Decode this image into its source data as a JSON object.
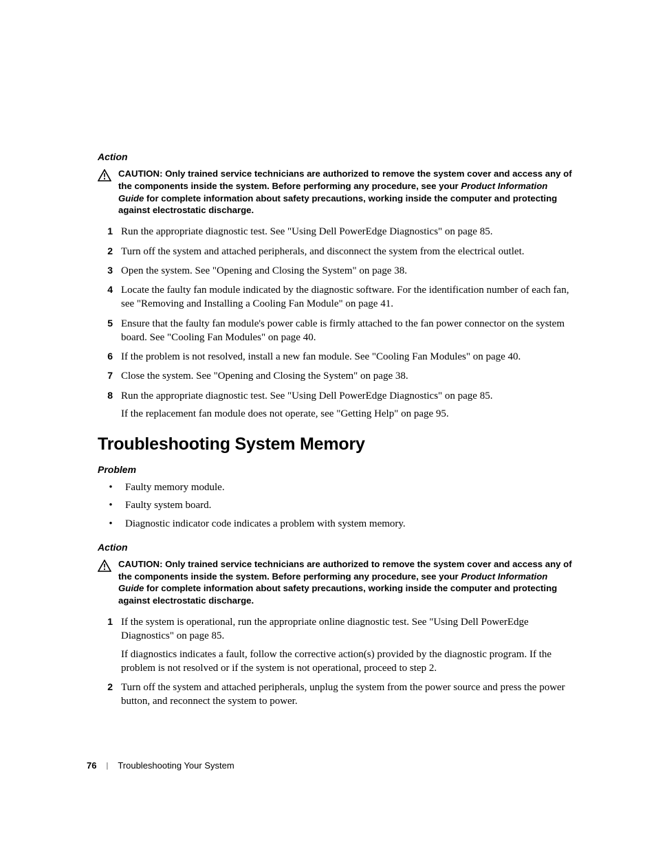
{
  "section1": {
    "subhead": "Action",
    "caution": {
      "label": "CAUTION:",
      "text1": " Only trained service technicians are authorized to remove the system cover and access any of the components inside the system. Before performing any procedure, see your ",
      "pig": "Product Information Guide",
      "text2": " for complete information about safety precautions, working inside the computer and protecting against electrostatic discharge."
    },
    "steps": [
      {
        "n": "1",
        "text": "Run the appropriate diagnostic test. See \"Using Dell PowerEdge Diagnostics\" on page 85."
      },
      {
        "n": "2",
        "text": "Turn off the system and attached peripherals, and disconnect the system from the electrical outlet."
      },
      {
        "n": "3",
        "text": "Open the system. See \"Opening and Closing the System\" on page 38."
      },
      {
        "n": "4",
        "text": "Locate the faulty fan module indicated by the diagnostic software. For the identification number of each fan, see \"Removing and Installing a Cooling Fan Module\" on page 41."
      },
      {
        "n": "5",
        "text": "Ensure that the faulty fan module's power cable is firmly attached to the fan power connector on the system board. See \"Cooling Fan Modules\" on page 40."
      },
      {
        "n": "6",
        "text": "If the problem is not resolved, install a new fan module. See \"Cooling Fan Modules\" on page 40."
      },
      {
        "n": "7",
        "text": "Close the system. See \"Opening and Closing the System\" on page 38."
      },
      {
        "n": "8",
        "text": "Run the appropriate diagnostic test. See \"Using Dell PowerEdge Diagnostics\" on page 85.",
        "extra": "If the replacement fan module does not operate, see \"Getting Help\" on page 95."
      }
    ]
  },
  "heading": "Troubleshooting System Memory",
  "section2": {
    "problem_subhead": "Problem",
    "problems": [
      "Faulty memory module.",
      "Faulty system board.",
      "Diagnostic indicator code indicates a problem with system memory."
    ],
    "action_subhead": "Action",
    "caution": {
      "label": "CAUTION:",
      "text1": " Only trained service technicians are authorized to remove the system cover and access any of the components inside the system. Before performing any procedure, see your ",
      "pig": "Product Information Guide",
      "text2": " for complete information about safety precautions, working inside the computer and protecting against electrostatic discharge."
    },
    "steps": [
      {
        "n": "1",
        "text": "If the system is operational, run the appropriate online diagnostic test. See \"Using Dell PowerEdge Diagnostics\" on page 85.",
        "extra": "If diagnostics indicates a fault, follow the corrective action(s) provided by the diagnostic program. If the problem is not resolved or if the system is not operational, proceed to step 2."
      },
      {
        "n": "2",
        "text": "Turn off the system and attached peripherals, unplug the system from the power source and press the power button, and reconnect the system to power."
      }
    ]
  },
  "footer": {
    "page": "76",
    "chapter": "Troubleshooting Your System"
  }
}
